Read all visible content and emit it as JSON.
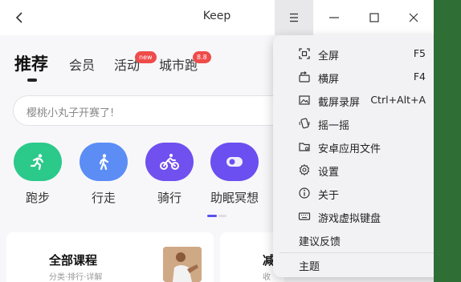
{
  "header": {
    "title": "Keep"
  },
  "tabs": [
    {
      "label": "推荐"
    },
    {
      "label": "会员"
    },
    {
      "label": "活动",
      "badge": "new"
    },
    {
      "label": "城市跑",
      "badge": "8.8"
    }
  ],
  "search": {
    "placeholder": "樱桃小丸子开赛了!"
  },
  "quick_actions": [
    {
      "label": "跑步",
      "icon": "runner-icon",
      "color": "#2bc98a"
    },
    {
      "label": "行走",
      "icon": "walker-icon",
      "color": "#5b8df5"
    },
    {
      "label": "骑行",
      "icon": "bicycle-icon",
      "color": "#7050ef"
    },
    {
      "label": "助眠冥想",
      "icon": "meditation-icon",
      "color": "#6b4ff0"
    }
  ],
  "cards": [
    {
      "title": "全部课程",
      "subtitle": "分类·排行·详解"
    },
    {
      "title": "减",
      "subtitle": "收"
    }
  ],
  "menu": {
    "items": [
      {
        "label": "全屏",
        "shortcut": "F5",
        "icon": "fullscreen-icon"
      },
      {
        "label": "横屏",
        "shortcut": "F4",
        "icon": "rotate-icon"
      },
      {
        "label": "截屏录屏",
        "shortcut": "Ctrl+Alt+A",
        "icon": "screenshot-icon"
      },
      {
        "label": "摇一摇",
        "shortcut": "",
        "icon": "shake-icon"
      },
      {
        "label": "安卓应用文件",
        "shortcut": "",
        "icon": "folder-icon"
      },
      {
        "label": "设置",
        "shortcut": "",
        "icon": "gear-icon"
      },
      {
        "label": "关于",
        "shortcut": "",
        "icon": "info-icon"
      },
      {
        "label": "游戏虚拟键盘",
        "shortcut": "",
        "icon": "keyboard-icon"
      },
      {
        "label": "建议反馈",
        "shortcut": ""
      },
      {
        "label": "主题",
        "shortcut": "",
        "submenu": true
      }
    ]
  }
}
